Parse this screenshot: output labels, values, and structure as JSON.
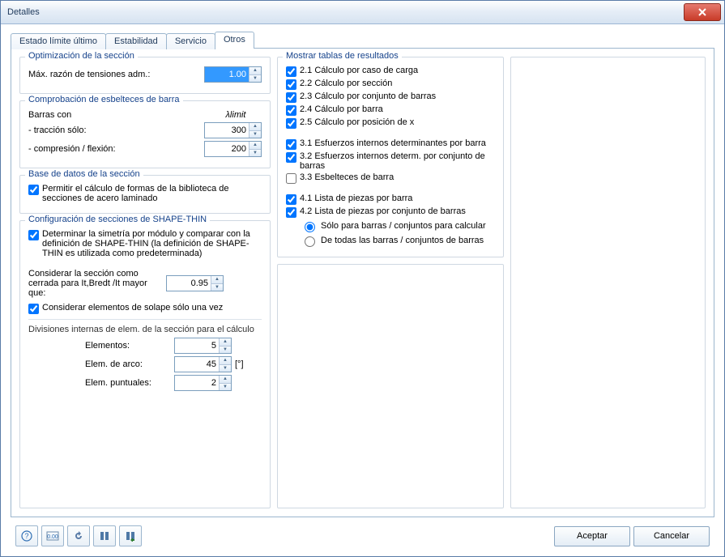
{
  "window": {
    "title": "Detalles"
  },
  "tabs": [
    "Estado límite último",
    "Estabilidad",
    "Servicio",
    "Otros"
  ],
  "active_tab_index": 3,
  "opt": {
    "header": "Optimización de la sección",
    "ratio_label": "Máx. razón de tensiones adm.:",
    "ratio_value": "1.00"
  },
  "slender": {
    "header": "Comprobación de esbelteces de barra",
    "bars_label": "Barras con",
    "limit_header": "λlimit",
    "tension_label": "- tracción sólo:",
    "tension_value": "300",
    "comp_label": "- compresión / flexión:",
    "comp_value": "200"
  },
  "db": {
    "header": "Base de datos de la sección",
    "allow_label": "Permitir el cálculo de formas de la biblioteca de secciones de acero laminado",
    "allow_checked": true
  },
  "shape": {
    "header": "Configuración de secciones de SHAPE-THIN",
    "sym_label": "Determinar la simetría por módulo y comparar con la definición de SHAPE-THIN (la definición de SHAPE-THIN es utilizada como predeterminada)",
    "sym_checked": true,
    "closed_label": "Considerar la sección como cerrada para It,Bredt /It mayor que:",
    "closed_value": "0.95",
    "overlap_label": "Considerar elementos de solape sólo una vez",
    "overlap_checked": true,
    "divisions_label": "Divisiones internas de elem. de la sección para el cálculo",
    "elements_label": "Elementos:",
    "elements_value": "5",
    "arc_label": "Elem. de arco:",
    "arc_value": "45",
    "arc_unit": "[°]",
    "point_label": "Elem. puntuales:",
    "point_value": "2"
  },
  "tables": {
    "header": "Mostrar tablas de resultados",
    "items_a": [
      {
        "label": "2.1 Cálculo por caso de carga",
        "checked": true
      },
      {
        "label": "2.2 Cálculo por sección",
        "checked": true
      },
      {
        "label": "2.3 Cálculo por conjunto de barras",
        "checked": true
      },
      {
        "label": "2.4 Cálculo por barra",
        "checked": true
      },
      {
        "label": "2.5 Cálculo por posición de x",
        "checked": true
      }
    ],
    "items_b": [
      {
        "label": "3.1 Esfuerzos internos determinantes por barra",
        "checked": true
      },
      {
        "label": "3.2 Esfuerzos internos determ. por conjunto de barras",
        "checked": true
      },
      {
        "label": "3.3 Esbelteces de barra",
        "checked": false
      }
    ],
    "items_c": [
      {
        "label": "4.1 Lista de piezas por barra",
        "checked": true
      },
      {
        "label": "4.2 Lista de piezas por conjunto de barras",
        "checked": true
      }
    ],
    "radios": [
      {
        "label": "Sólo para barras / conjuntos para calcular",
        "checked": true
      },
      {
        "label": "De todas las barras / conjuntos de barras",
        "checked": false
      }
    ]
  },
  "buttons": {
    "ok": "Aceptar",
    "cancel": "Cancelar"
  }
}
